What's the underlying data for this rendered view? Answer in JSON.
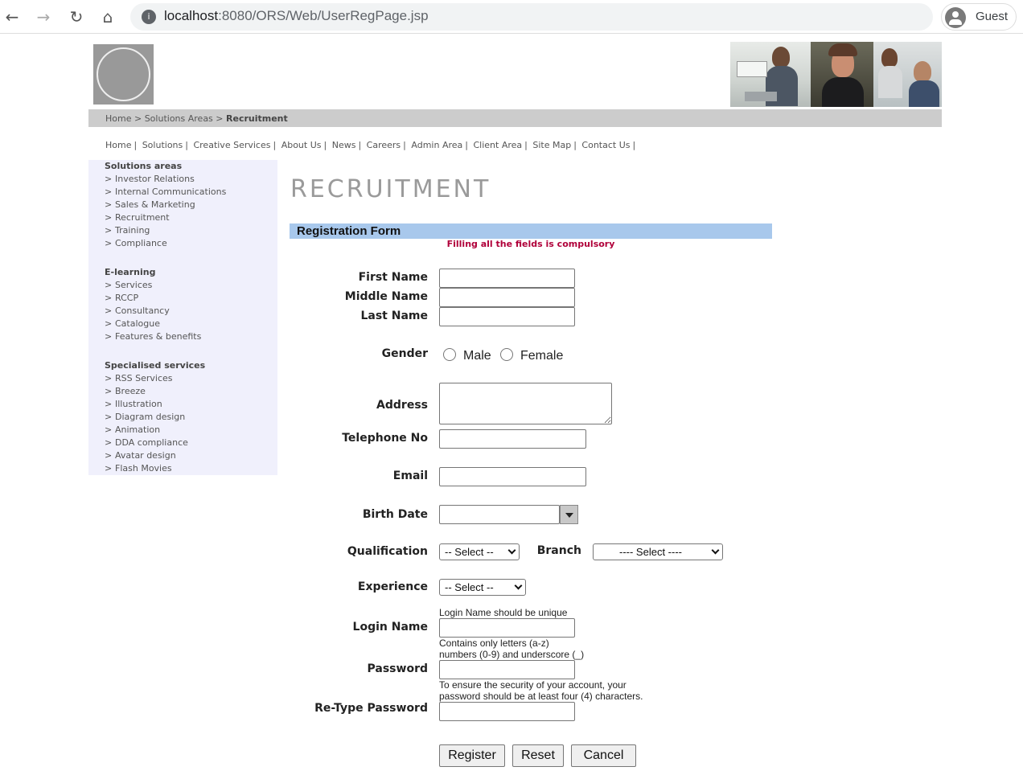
{
  "browser": {
    "url_host": "localhost",
    "url_path": ":8080/ORS/Web/UserRegPage.jsp",
    "profile_label": "Guest"
  },
  "breadcrumb": {
    "home": "Home",
    "sep1": " > ",
    "solutions": "Solutions Areas",
    "sep2": " > ",
    "current": "Recruitment"
  },
  "topnav": [
    "Home",
    "Solutions",
    "Creative Services",
    "About Us",
    "News",
    "Careers",
    "Admin Area",
    "Client Area",
    "Site Map",
    "Contact Us"
  ],
  "sidebar": {
    "sections": [
      {
        "title": "Solutions areas",
        "items": [
          "Investor Relations",
          "Internal Communications",
          "Sales & Marketing",
          "Recruitment",
          "Training",
          "Compliance"
        ]
      },
      {
        "title": "E-learning",
        "items": [
          "Services",
          "RCCP",
          "Consultancy",
          "Catalogue",
          "Features & benefits"
        ]
      },
      {
        "title": "Specialised services",
        "items": [
          "RSS Services",
          "Breeze",
          "Illustration",
          "Diagram design",
          "Animation",
          "DDA compliance",
          "Avatar design",
          "Flash Movies"
        ]
      }
    ]
  },
  "page": {
    "heading": "RECRUITMENT",
    "form_title": "Registration Form",
    "compulsory_note": "Filling all the fields is compulsory"
  },
  "form": {
    "first_name_label": "First Name",
    "middle_name_label": "Middle Name",
    "last_name_label": "Last Name",
    "gender_label": "Gender",
    "gender_male": "Male",
    "gender_female": "Female",
    "address_label": "Address",
    "telephone_label": "Telephone No",
    "email_label": "Email",
    "birth_date_label": "Birth Date",
    "qualification_label": "Qualification",
    "qualification_selected": "-- Select --",
    "branch_label": "Branch",
    "branch_selected": "---- Select ----",
    "experience_label": "Experience",
    "experience_selected": "-- Select --",
    "login_hint": "Login Name should be unique",
    "login_label": "Login Name",
    "login_rule_1": "Contains only letters (a-z)",
    "login_rule_2": "numbers (0-9) and underscore (_)",
    "password_label": "Password",
    "password_rule_1": "To ensure the security of your account, your",
    "password_rule_2": "password should be at least four (4) characters.",
    "retype_label": "Re-Type Password"
  },
  "buttons": {
    "register": "Register",
    "reset": "Reset",
    "cancel": "Cancel"
  }
}
